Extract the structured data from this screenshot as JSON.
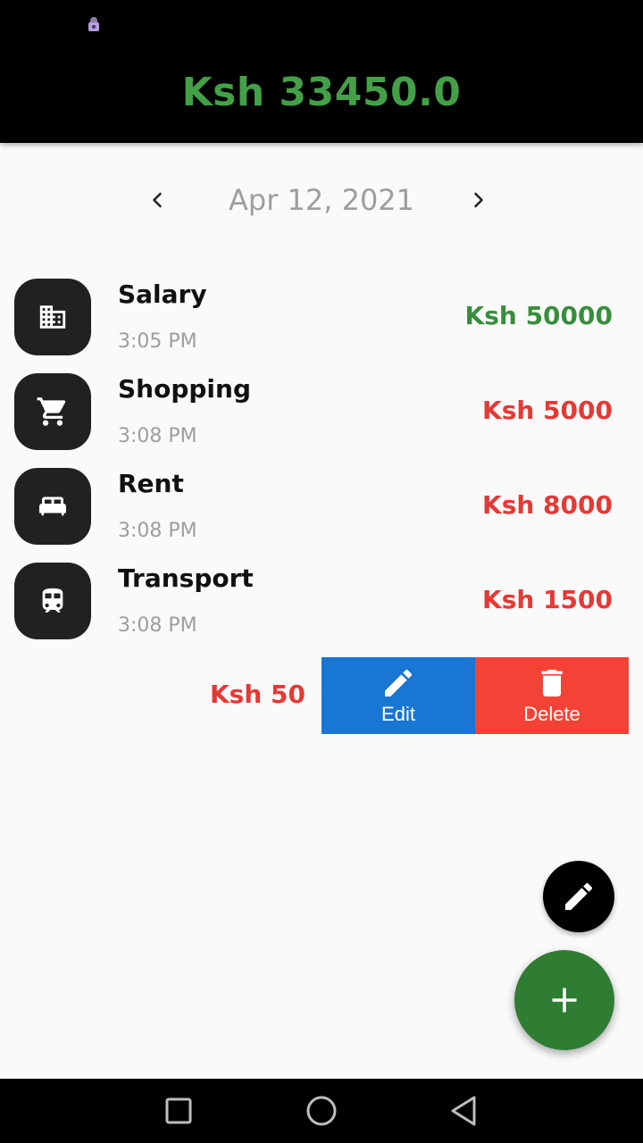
{
  "header": {
    "balance": "Ksh 33450.0",
    "balance_color": "#43a047"
  },
  "date_nav": {
    "prev_icon": "chevron-left-icon",
    "date": "Apr 12, 2021",
    "next_icon": "chevron-right-icon"
  },
  "transactions": [
    {
      "icon": "building-icon",
      "title": "Salary",
      "time": "3:05 PM",
      "amount": "Ksh 50000",
      "color": "#388e3c"
    },
    {
      "icon": "cart-icon",
      "title": "Shopping",
      "time": "3:08 PM",
      "amount": "Ksh 5000",
      "color": "#e53935"
    },
    {
      "icon": "bed-icon",
      "title": "Rent",
      "time": "3:08 PM",
      "amount": "Ksh 8000",
      "color": "#e53935"
    },
    {
      "icon": "train-icon",
      "title": "Transport",
      "time": "3:08 PM",
      "amount": "Ksh 1500",
      "color": "#e53935"
    }
  ],
  "swiped_item": {
    "amount": "Ksh 50",
    "color": "#e53935",
    "edit_label": "Edit",
    "edit_color": "#1976d2",
    "delete_label": "Delete",
    "delete_color": "#f44336"
  },
  "fabs": {
    "small_icon": "pencil-icon",
    "large_icon": "plus-icon",
    "large_color": "#2e7d32"
  },
  "system_nav": [
    "square-recents-icon",
    "circle-home-icon",
    "triangle-back-icon"
  ]
}
